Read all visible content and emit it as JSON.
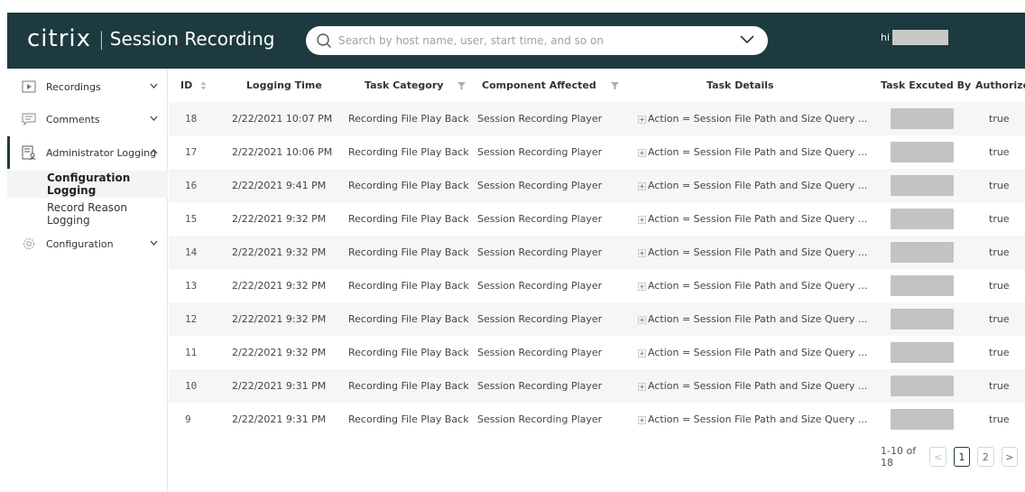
{
  "app": {
    "logo_text": "citrix",
    "separator": "|",
    "product": "Session Recording"
  },
  "search": {
    "placeholder": "Search by host name, user, start time, and so on",
    "value": ""
  },
  "user": {
    "greeting": "hi"
  },
  "sidebar": {
    "items": [
      {
        "label": "Recordings",
        "icon": "play-icon"
      },
      {
        "label": "Comments",
        "icon": "comment-icon"
      },
      {
        "label": "Administrator Logging",
        "icon": "admin-log-icon",
        "expanded": true
      },
      {
        "label": "Configuration",
        "icon": "gear-icon"
      }
    ],
    "subitems": [
      {
        "label": "Configuration Logging",
        "selected": true
      },
      {
        "label": "Record Reason Logging",
        "selected": false
      }
    ]
  },
  "table": {
    "columns": [
      "ID",
      "Logging Time",
      "Task Category",
      "Component Affected",
      "Task Details",
      "Task Excuted By",
      "Authorized"
    ],
    "rows": [
      {
        "id": "18",
        "time": "2/22/2021 10:07 PM",
        "category": "Recording File Play Back",
        "component": "Session Recording Player",
        "details": "Action = Session File Path and Size Query ...",
        "authorized": "true"
      },
      {
        "id": "17",
        "time": "2/22/2021 10:06 PM",
        "category": "Recording File Play Back",
        "component": "Session Recording Player",
        "details": "Action = Session File Path and Size Query ...",
        "authorized": "true"
      },
      {
        "id": "16",
        "time": "2/22/2021 9:41 PM",
        "category": "Recording File Play Back",
        "component": "Session Recording Player",
        "details": "Action = Session File Path and Size Query ...",
        "authorized": "true"
      },
      {
        "id": "15",
        "time": "2/22/2021 9:32 PM",
        "category": "Recording File Play Back",
        "component": "Session Recording Player",
        "details": "Action = Session File Path and Size Query ...",
        "authorized": "true"
      },
      {
        "id": "14",
        "time": "2/22/2021 9:32 PM",
        "category": "Recording File Play Back",
        "component": "Session Recording Player",
        "details": "Action = Session File Path and Size Query ...",
        "authorized": "true"
      },
      {
        "id": "13",
        "time": "2/22/2021 9:32 PM",
        "category": "Recording File Play Back",
        "component": "Session Recording Player",
        "details": "Action = Session File Path and Size Query ...",
        "authorized": "true"
      },
      {
        "id": "12",
        "time": "2/22/2021 9:32 PM",
        "category": "Recording File Play Back",
        "component": "Session Recording Player",
        "details": "Action = Session File Path and Size Query ...",
        "authorized": "true"
      },
      {
        "id": "11",
        "time": "2/22/2021 9:32 PM",
        "category": "Recording File Play Back",
        "component": "Session Recording Player",
        "details": "Action = Session File Path and Size Query ...",
        "authorized": "true"
      },
      {
        "id": "10",
        "time": "2/22/2021 9:31 PM",
        "category": "Recording File Play Back",
        "component": "Session Recording Player",
        "details": "Action = Session File Path and Size Query ...",
        "authorized": "true"
      },
      {
        "id": "9",
        "time": "2/22/2021 9:31 PM",
        "category": "Recording File Play Back",
        "component": "Session Recording Player",
        "details": "Action = Session File Path and Size Query ...",
        "authorized": "true"
      }
    ]
  },
  "pagination": {
    "summary": "1-10 of 18",
    "prev": "<",
    "pages": [
      "1",
      "2"
    ],
    "next": ">",
    "current": "1"
  },
  "colors": {
    "header_bg": "#1d3a40",
    "row_stripe": "#f5f6f6",
    "redaction": "#c3c3c3"
  }
}
